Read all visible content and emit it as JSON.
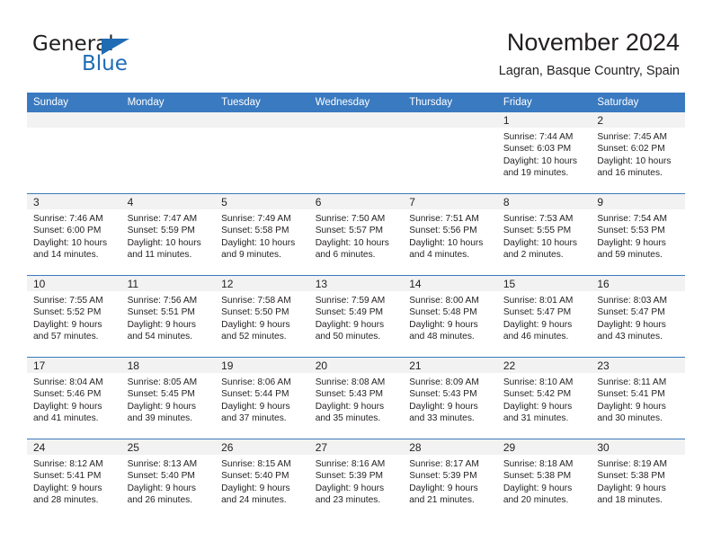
{
  "brand": {
    "name_part1": "General",
    "name_part2": "Blue",
    "accent_color": "#1f6cb4"
  },
  "header": {
    "title": "November 2024",
    "subtitle": "Lagran, Basque Country, Spain"
  },
  "calendar": {
    "header_color": "#3a7ac0",
    "daynum_band_color": "#f2f2f2",
    "weekday_names": [
      "Sunday",
      "Monday",
      "Tuesday",
      "Wednesday",
      "Thursday",
      "Friday",
      "Saturday"
    ],
    "weeks": [
      [
        {
          "day": "",
          "sunrise": "",
          "sunset": "",
          "daylight_line1": "",
          "daylight_line2": "",
          "empty": true
        },
        {
          "day": "",
          "sunrise": "",
          "sunset": "",
          "daylight_line1": "",
          "daylight_line2": "",
          "empty": true
        },
        {
          "day": "",
          "sunrise": "",
          "sunset": "",
          "daylight_line1": "",
          "daylight_line2": "",
          "empty": true
        },
        {
          "day": "",
          "sunrise": "",
          "sunset": "",
          "daylight_line1": "",
          "daylight_line2": "",
          "empty": true
        },
        {
          "day": "",
          "sunrise": "",
          "sunset": "",
          "daylight_line1": "",
          "daylight_line2": "",
          "empty": true
        },
        {
          "day": "1",
          "sunrise": "Sunrise: 7:44 AM",
          "sunset": "Sunset: 6:03 PM",
          "daylight_line1": "Daylight: 10 hours",
          "daylight_line2": "and 19 minutes."
        },
        {
          "day": "2",
          "sunrise": "Sunrise: 7:45 AM",
          "sunset": "Sunset: 6:02 PM",
          "daylight_line1": "Daylight: 10 hours",
          "daylight_line2": "and 16 minutes."
        }
      ],
      [
        {
          "day": "3",
          "sunrise": "Sunrise: 7:46 AM",
          "sunset": "Sunset: 6:00 PM",
          "daylight_line1": "Daylight: 10 hours",
          "daylight_line2": "and 14 minutes."
        },
        {
          "day": "4",
          "sunrise": "Sunrise: 7:47 AM",
          "sunset": "Sunset: 5:59 PM",
          "daylight_line1": "Daylight: 10 hours",
          "daylight_line2": "and 11 minutes."
        },
        {
          "day": "5",
          "sunrise": "Sunrise: 7:49 AM",
          "sunset": "Sunset: 5:58 PM",
          "daylight_line1": "Daylight: 10 hours",
          "daylight_line2": "and 9 minutes."
        },
        {
          "day": "6",
          "sunrise": "Sunrise: 7:50 AM",
          "sunset": "Sunset: 5:57 PM",
          "daylight_line1": "Daylight: 10 hours",
          "daylight_line2": "and 6 minutes."
        },
        {
          "day": "7",
          "sunrise": "Sunrise: 7:51 AM",
          "sunset": "Sunset: 5:56 PM",
          "daylight_line1": "Daylight: 10 hours",
          "daylight_line2": "and 4 minutes."
        },
        {
          "day": "8",
          "sunrise": "Sunrise: 7:53 AM",
          "sunset": "Sunset: 5:55 PM",
          "daylight_line1": "Daylight: 10 hours",
          "daylight_line2": "and 2 minutes."
        },
        {
          "day": "9",
          "sunrise": "Sunrise: 7:54 AM",
          "sunset": "Sunset: 5:53 PM",
          "daylight_line1": "Daylight: 9 hours",
          "daylight_line2": "and 59 minutes."
        }
      ],
      [
        {
          "day": "10",
          "sunrise": "Sunrise: 7:55 AM",
          "sunset": "Sunset: 5:52 PM",
          "daylight_line1": "Daylight: 9 hours",
          "daylight_line2": "and 57 minutes."
        },
        {
          "day": "11",
          "sunrise": "Sunrise: 7:56 AM",
          "sunset": "Sunset: 5:51 PM",
          "daylight_line1": "Daylight: 9 hours",
          "daylight_line2": "and 54 minutes."
        },
        {
          "day": "12",
          "sunrise": "Sunrise: 7:58 AM",
          "sunset": "Sunset: 5:50 PM",
          "daylight_line1": "Daylight: 9 hours",
          "daylight_line2": "and 52 minutes."
        },
        {
          "day": "13",
          "sunrise": "Sunrise: 7:59 AM",
          "sunset": "Sunset: 5:49 PM",
          "daylight_line1": "Daylight: 9 hours",
          "daylight_line2": "and 50 minutes."
        },
        {
          "day": "14",
          "sunrise": "Sunrise: 8:00 AM",
          "sunset": "Sunset: 5:48 PM",
          "daylight_line1": "Daylight: 9 hours",
          "daylight_line2": "and 48 minutes."
        },
        {
          "day": "15",
          "sunrise": "Sunrise: 8:01 AM",
          "sunset": "Sunset: 5:47 PM",
          "daylight_line1": "Daylight: 9 hours",
          "daylight_line2": "and 46 minutes."
        },
        {
          "day": "16",
          "sunrise": "Sunrise: 8:03 AM",
          "sunset": "Sunset: 5:47 PM",
          "daylight_line1": "Daylight: 9 hours",
          "daylight_line2": "and 43 minutes."
        }
      ],
      [
        {
          "day": "17",
          "sunrise": "Sunrise: 8:04 AM",
          "sunset": "Sunset: 5:46 PM",
          "daylight_line1": "Daylight: 9 hours",
          "daylight_line2": "and 41 minutes."
        },
        {
          "day": "18",
          "sunrise": "Sunrise: 8:05 AM",
          "sunset": "Sunset: 5:45 PM",
          "daylight_line1": "Daylight: 9 hours",
          "daylight_line2": "and 39 minutes."
        },
        {
          "day": "19",
          "sunrise": "Sunrise: 8:06 AM",
          "sunset": "Sunset: 5:44 PM",
          "daylight_line1": "Daylight: 9 hours",
          "daylight_line2": "and 37 minutes."
        },
        {
          "day": "20",
          "sunrise": "Sunrise: 8:08 AM",
          "sunset": "Sunset: 5:43 PM",
          "daylight_line1": "Daylight: 9 hours",
          "daylight_line2": "and 35 minutes."
        },
        {
          "day": "21",
          "sunrise": "Sunrise: 8:09 AM",
          "sunset": "Sunset: 5:43 PM",
          "daylight_line1": "Daylight: 9 hours",
          "daylight_line2": "and 33 minutes."
        },
        {
          "day": "22",
          "sunrise": "Sunrise: 8:10 AM",
          "sunset": "Sunset: 5:42 PM",
          "daylight_line1": "Daylight: 9 hours",
          "daylight_line2": "and 31 minutes."
        },
        {
          "day": "23",
          "sunrise": "Sunrise: 8:11 AM",
          "sunset": "Sunset: 5:41 PM",
          "daylight_line1": "Daylight: 9 hours",
          "daylight_line2": "and 30 minutes."
        }
      ],
      [
        {
          "day": "24",
          "sunrise": "Sunrise: 8:12 AM",
          "sunset": "Sunset: 5:41 PM",
          "daylight_line1": "Daylight: 9 hours",
          "daylight_line2": "and 28 minutes."
        },
        {
          "day": "25",
          "sunrise": "Sunrise: 8:13 AM",
          "sunset": "Sunset: 5:40 PM",
          "daylight_line1": "Daylight: 9 hours",
          "daylight_line2": "and 26 minutes."
        },
        {
          "day": "26",
          "sunrise": "Sunrise: 8:15 AM",
          "sunset": "Sunset: 5:40 PM",
          "daylight_line1": "Daylight: 9 hours",
          "daylight_line2": "and 24 minutes."
        },
        {
          "day": "27",
          "sunrise": "Sunrise: 8:16 AM",
          "sunset": "Sunset: 5:39 PM",
          "daylight_line1": "Daylight: 9 hours",
          "daylight_line2": "and 23 minutes."
        },
        {
          "day": "28",
          "sunrise": "Sunrise: 8:17 AM",
          "sunset": "Sunset: 5:39 PM",
          "daylight_line1": "Daylight: 9 hours",
          "daylight_line2": "and 21 minutes."
        },
        {
          "day": "29",
          "sunrise": "Sunrise: 8:18 AM",
          "sunset": "Sunset: 5:38 PM",
          "daylight_line1": "Daylight: 9 hours",
          "daylight_line2": "and 20 minutes."
        },
        {
          "day": "30",
          "sunrise": "Sunrise: 8:19 AM",
          "sunset": "Sunset: 5:38 PM",
          "daylight_line1": "Daylight: 9 hours",
          "daylight_line2": "and 18 minutes."
        }
      ]
    ]
  }
}
